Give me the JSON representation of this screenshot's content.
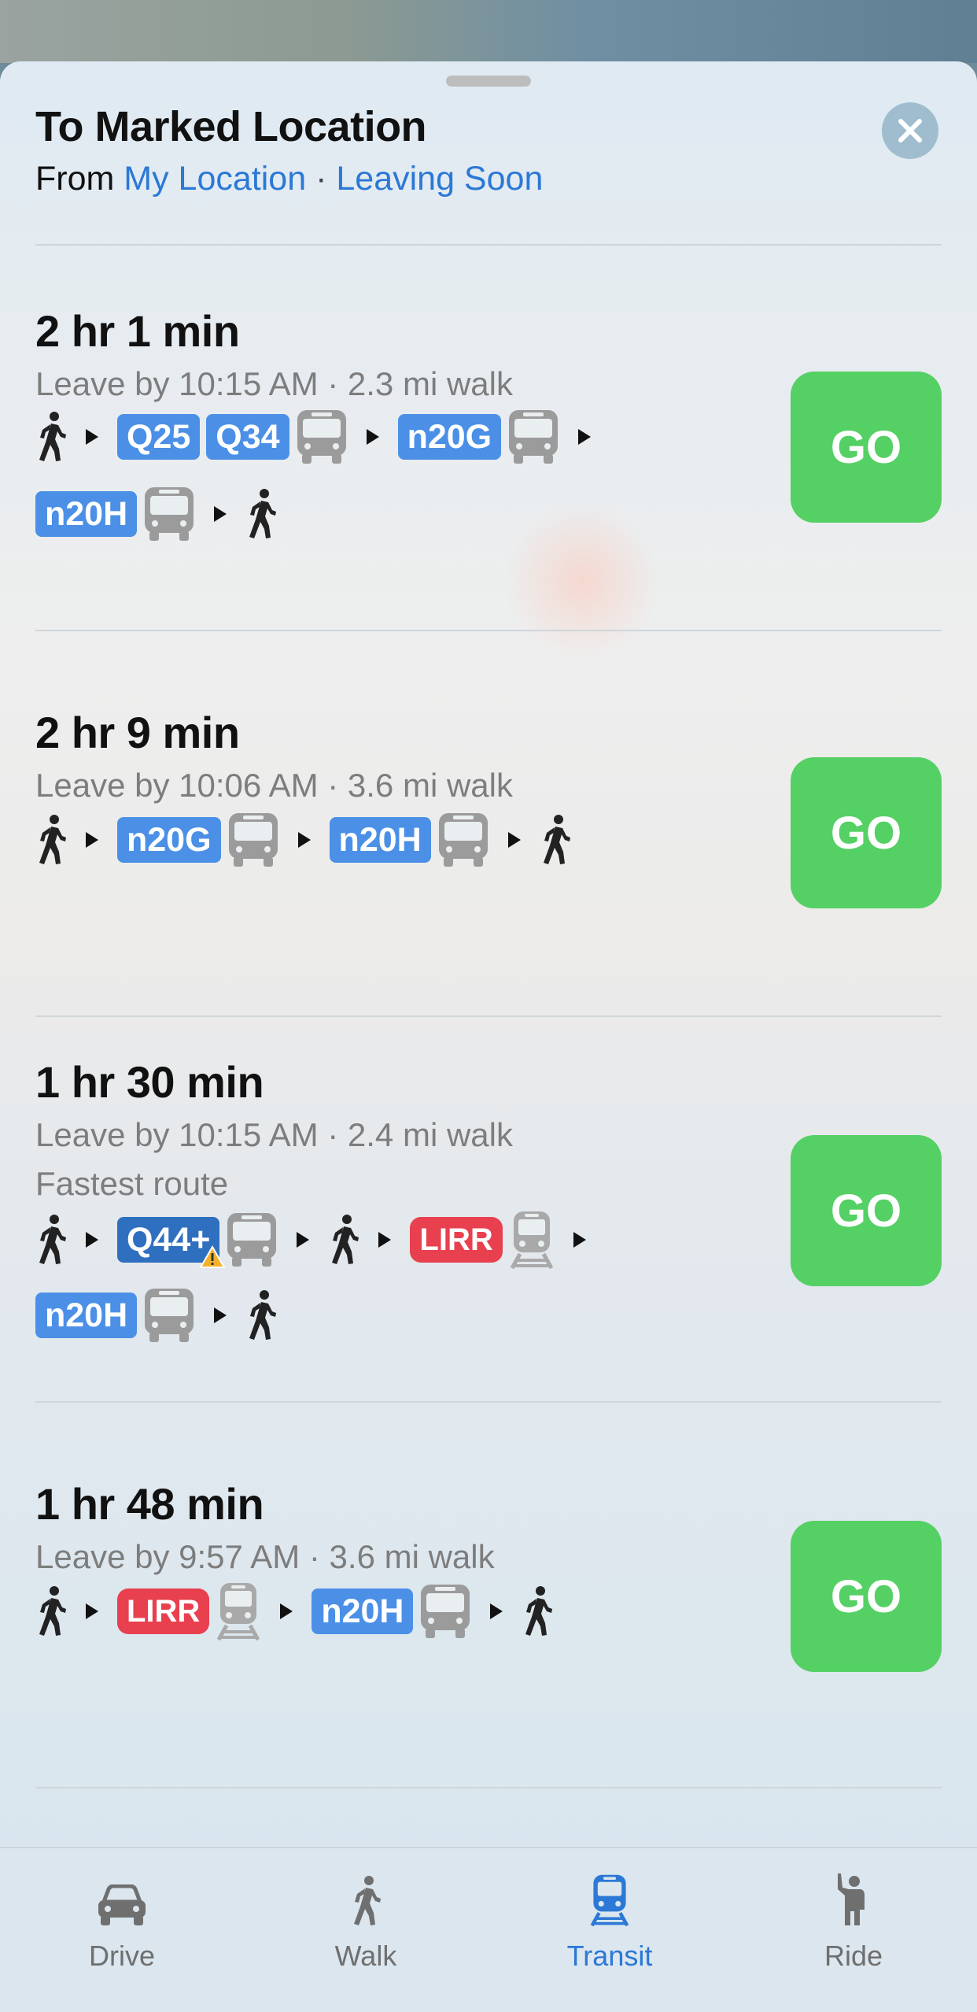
{
  "header": {
    "title": "To Marked Location",
    "from_prefix": "From",
    "from_location": "My Location",
    "separator": "·",
    "leaving": "Leaving Soon"
  },
  "routes": [
    {
      "duration": "2 hr 1 min",
      "meta": "Leave by 10:15 AM · 2.3 mi walk",
      "note": "",
      "badges": [
        "Q25",
        "Q34",
        "n20G",
        "n20H"
      ],
      "go_label": "GO"
    },
    {
      "duration": "2 hr 9 min",
      "meta": "Leave by 10:06 AM · 3.6 mi walk",
      "note": "",
      "badges": [
        "n20G",
        "n20H"
      ],
      "go_label": "GO"
    },
    {
      "duration": "1 hr 30 min",
      "meta": "Leave by 10:15 AM · 2.4 mi walk",
      "note": "Fastest route",
      "badges": [
        "Q44+",
        "LIRR",
        "n20H"
      ],
      "go_label": "GO"
    },
    {
      "duration": "1 hr 48 min",
      "meta": "Leave by 9:57 AM · 3.6 mi walk",
      "note": "",
      "badges": [
        "LIRR",
        "n20H"
      ],
      "go_label": "GO"
    }
  ],
  "tabs": [
    {
      "label": "Drive",
      "icon": "car-icon",
      "active": false
    },
    {
      "label": "Walk",
      "icon": "walk-icon",
      "active": false
    },
    {
      "label": "Transit",
      "icon": "train-icon",
      "active": true
    },
    {
      "label": "Ride",
      "icon": "ride-icon",
      "active": false
    }
  ],
  "colors": {
    "accent": "#2b78d6",
    "go": "#55d064",
    "bus_badge": "#4b90e6",
    "lirr_badge": "#e8404f"
  }
}
